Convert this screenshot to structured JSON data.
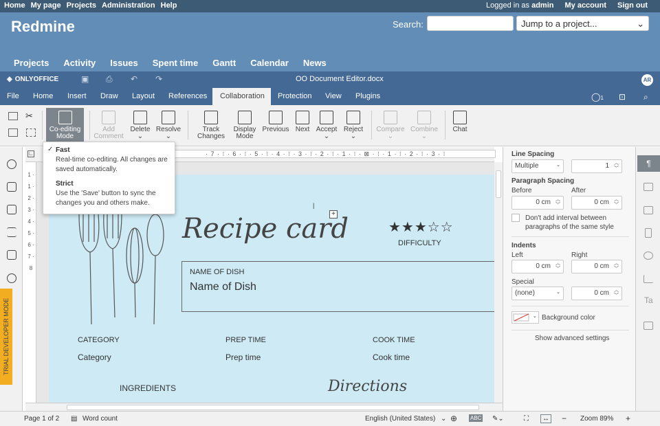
{
  "topmenu": {
    "home": "Home",
    "mypage": "My page",
    "projects": "Projects",
    "administration": "Administration",
    "help": "Help",
    "logged_in_as": "Logged in as",
    "user": "admin",
    "my_account": "My account",
    "sign_out": "Sign out"
  },
  "header": {
    "logo": "Redmine",
    "search_label": "Search:",
    "search_value": "",
    "jump": "Jump to a project..."
  },
  "mainmenu": [
    "Projects",
    "Activity",
    "Issues",
    "Spent time",
    "Gantt",
    "Calendar",
    "News"
  ],
  "oo": {
    "brand": "ONLYOFFICE",
    "doc_title": "OO Document Editor.docx",
    "avatar": "AR"
  },
  "tabs": [
    "File",
    "Home",
    "Insert",
    "Draw",
    "Layout",
    "References",
    "Collaboration",
    "Protection",
    "View",
    "Plugins"
  ],
  "toolbar": {
    "coediting": "Co-editing Mode",
    "add_comment": "Add Comment",
    "delete": "Delete",
    "resolve": "Resolve",
    "track_changes": "Track Changes",
    "display_mode": "Display Mode",
    "previous": "Previous",
    "next": "Next",
    "accept": "Accept",
    "reject": "Reject",
    "compare": "Compare",
    "combine": "Combine",
    "chat": "Chat",
    "users": "1"
  },
  "popup": {
    "fast_title": "Fast",
    "fast_desc": "Real-time co-editing. All changes are saved automatically.",
    "strict_title": "Strict",
    "strict_desc": "Use the 'Save' button to sync the changes you and others make."
  },
  "ruler": {
    "h": "· 7 · ⁝ · 6 · ⁝ · 5 · ⁝ · 4 · ⁝ · 3 · ⁝ · 2 · ⁝ · 1 · ⁝ · ⊠ · ⁝ · 1 · ⁝ · 2 · ⁝ · 3 · ⁝",
    "v": "1 · 1 · 2 · 3 · 4 · 5 · 6 · 7 · 8"
  },
  "trial": "TRIAL DEVELOPER MODE",
  "doc": {
    "title": "Recipe card",
    "difficulty": "DIFFICULTY",
    "stars": "★★★☆☆",
    "dish_label": "NAME OF DISH",
    "dish_value": "Name of Dish",
    "category_label": "CATEGORY",
    "category_value": "Category",
    "prep_label": "PREP TIME",
    "prep_value": "Prep time",
    "cook_label": "COOK TIME",
    "cook_value": "Cook time",
    "ingredients": "INGREDIENTS",
    "directions": "Directions"
  },
  "rightpanel": {
    "line_spacing": "Line Spacing",
    "line_mode": "Multiple",
    "line_value": "1",
    "para_spacing": "Paragraph Spacing",
    "before": "Before",
    "after": "After",
    "before_value": "0 cm",
    "after_value": "0 cm",
    "dont_add": "Don't add interval between paragraphs of the same style",
    "indents": "Indents",
    "left": "Left",
    "right": "Right",
    "left_value": "0 cm",
    "right_value": "0 cm",
    "special": "Special",
    "special_mode": "(none)",
    "special_value": "0 cm",
    "bg_color": "Background color",
    "advanced": "Show advanced settings"
  },
  "status": {
    "page": "Page 1 of 2",
    "word_count": "Word count",
    "language": "English (United States)",
    "zoom": "Zoom 89%"
  },
  "colors": {
    "accent": "#446995",
    "header": "#628db6",
    "topbar": "#3e5b76",
    "page": "#cdeaf5",
    "trial": "#f3ad20"
  }
}
